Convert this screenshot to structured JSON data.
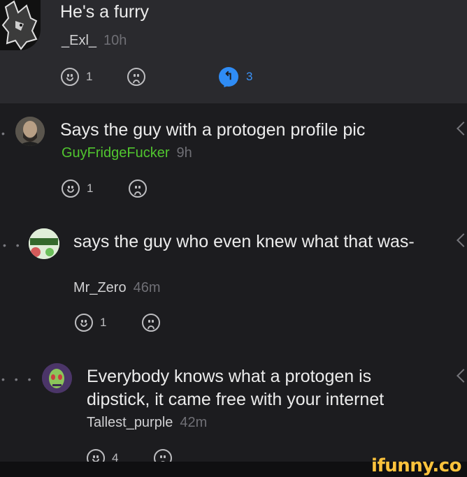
{
  "comments": [
    {
      "text": "He's a furry",
      "username": "_Exl_",
      "time": "10h",
      "likes": "1",
      "replies": "3",
      "reply_icon": "reply-arrow-icon",
      "reply_glyph": "↰"
    },
    {
      "text": "Says the guy with a protogen profile pic",
      "username": "GuyFridgeFucker",
      "time": "9h",
      "likes": "1",
      "username_color": "#51c62f"
    },
    {
      "text": "says the guy who even knew what that was-",
      "username": "Mr_Zero",
      "time": "46m",
      "likes": "1",
      "thread_dots": "• •"
    },
    {
      "text": "Everybody knows what a protogen is dipstick, it came free with your internet",
      "username": "Tallest_purple",
      "time": "42m",
      "likes": "4",
      "thread_dots": "• • •"
    }
  ],
  "brand": {
    "text": "ifunny.co",
    "color": "#fbc23c"
  },
  "colors": {
    "background": "#1c1c1f",
    "highlight_band": "#2a2a2e",
    "reply_blue": "#2f8cf5"
  }
}
